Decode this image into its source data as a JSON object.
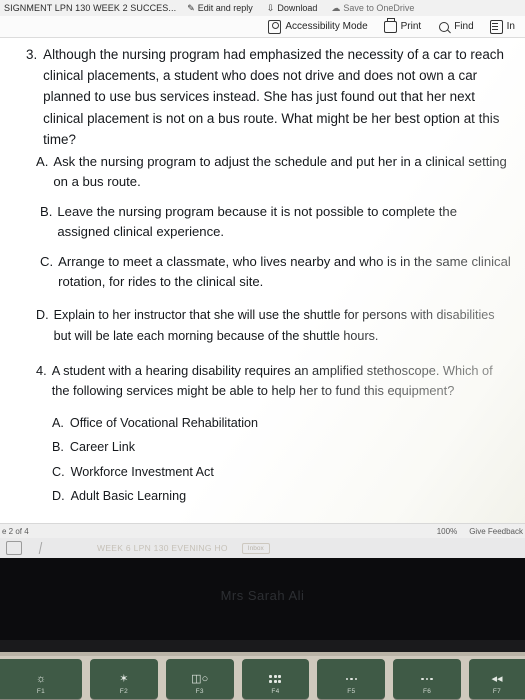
{
  "topbar": {
    "tab_title": "SIGNMENT LPN 130 WEEK 2 SUCCES...",
    "items": [
      {
        "icon": "pencil-icon",
        "label": "Edit and reply"
      },
      {
        "icon": "download-icon",
        "label": "Download"
      },
      {
        "icon": "cloud-icon",
        "label": "Save to OneDrive"
      }
    ]
  },
  "toolbar2": {
    "accessibility": "Accessibility Mode",
    "print": "Print",
    "find": "Find",
    "app": "In"
  },
  "document": {
    "q3": {
      "number": "3.",
      "text": "Although the nursing program had emphasized the necessity of a car to reach clinical placements, a student who does not drive and does not own a car planned to use bus services instead. She has just found out that her next clinical placement is not on a bus route. What might be her best option at this time?",
      "options": [
        {
          "label": "A.",
          "text": "Ask the nursing program to adjust the schedule and put her in a clinical setting on a bus route."
        },
        {
          "label": "B.",
          "text": "Leave the nursing program because it is not possible to complete the assigned clinical experience."
        },
        {
          "label": "C.",
          "text": "Arrange to meet a classmate, who lives nearby and who is in the same clinical rotation, for rides to the clinical site."
        },
        {
          "label": "D.",
          "text": "Explain to her instructor that she will use the shuttle for persons with disabilities but will be late each morning because of the shuttle hours."
        }
      ]
    },
    "q4": {
      "number": "4.",
      "text": "A student with a hearing disability requires an amplified stethoscope. Which of the following services might be able to help her to fund this equipment?",
      "options": [
        {
          "label": "A.",
          "text": "Office of Vocational Rehabilitation"
        },
        {
          "label": "B.",
          "text": "Career Link"
        },
        {
          "label": "C.",
          "text": "Workforce Investment Act"
        },
        {
          "label": "D.",
          "text": "Adult Basic Learning"
        }
      ]
    }
  },
  "statusbar": {
    "page": "e 2 of 4",
    "zoom": "100%",
    "feedback": "Give Feedback"
  },
  "ghost": {
    "title": "WEEK 6 LPN 130 EVENING HO",
    "chip": "Inbox"
  },
  "screen": {
    "watermark": "Mrs Sarah Ali"
  },
  "keyboard": {
    "keys": [
      {
        "icon": "brightness-low-icon",
        "glyph": "☀",
        "fn": "F1"
      },
      {
        "icon": "brightness-high-icon",
        "glyph": "☀",
        "fn": "F2"
      },
      {
        "icon": "task-view-icon",
        "glyph": "8o",
        "fn": "F3"
      },
      {
        "icon": "app-grid-icon",
        "glyph": "",
        "fn": "F4"
      },
      {
        "icon": "keyboard-backlight-icon",
        "glyph": "",
        "fn": "F5"
      },
      {
        "icon": "keyboard-backlight-up-icon",
        "glyph": "",
        "fn": "F6"
      },
      {
        "icon": "mute-icon",
        "glyph": "◀◀",
        "fn": "F7"
      }
    ]
  }
}
